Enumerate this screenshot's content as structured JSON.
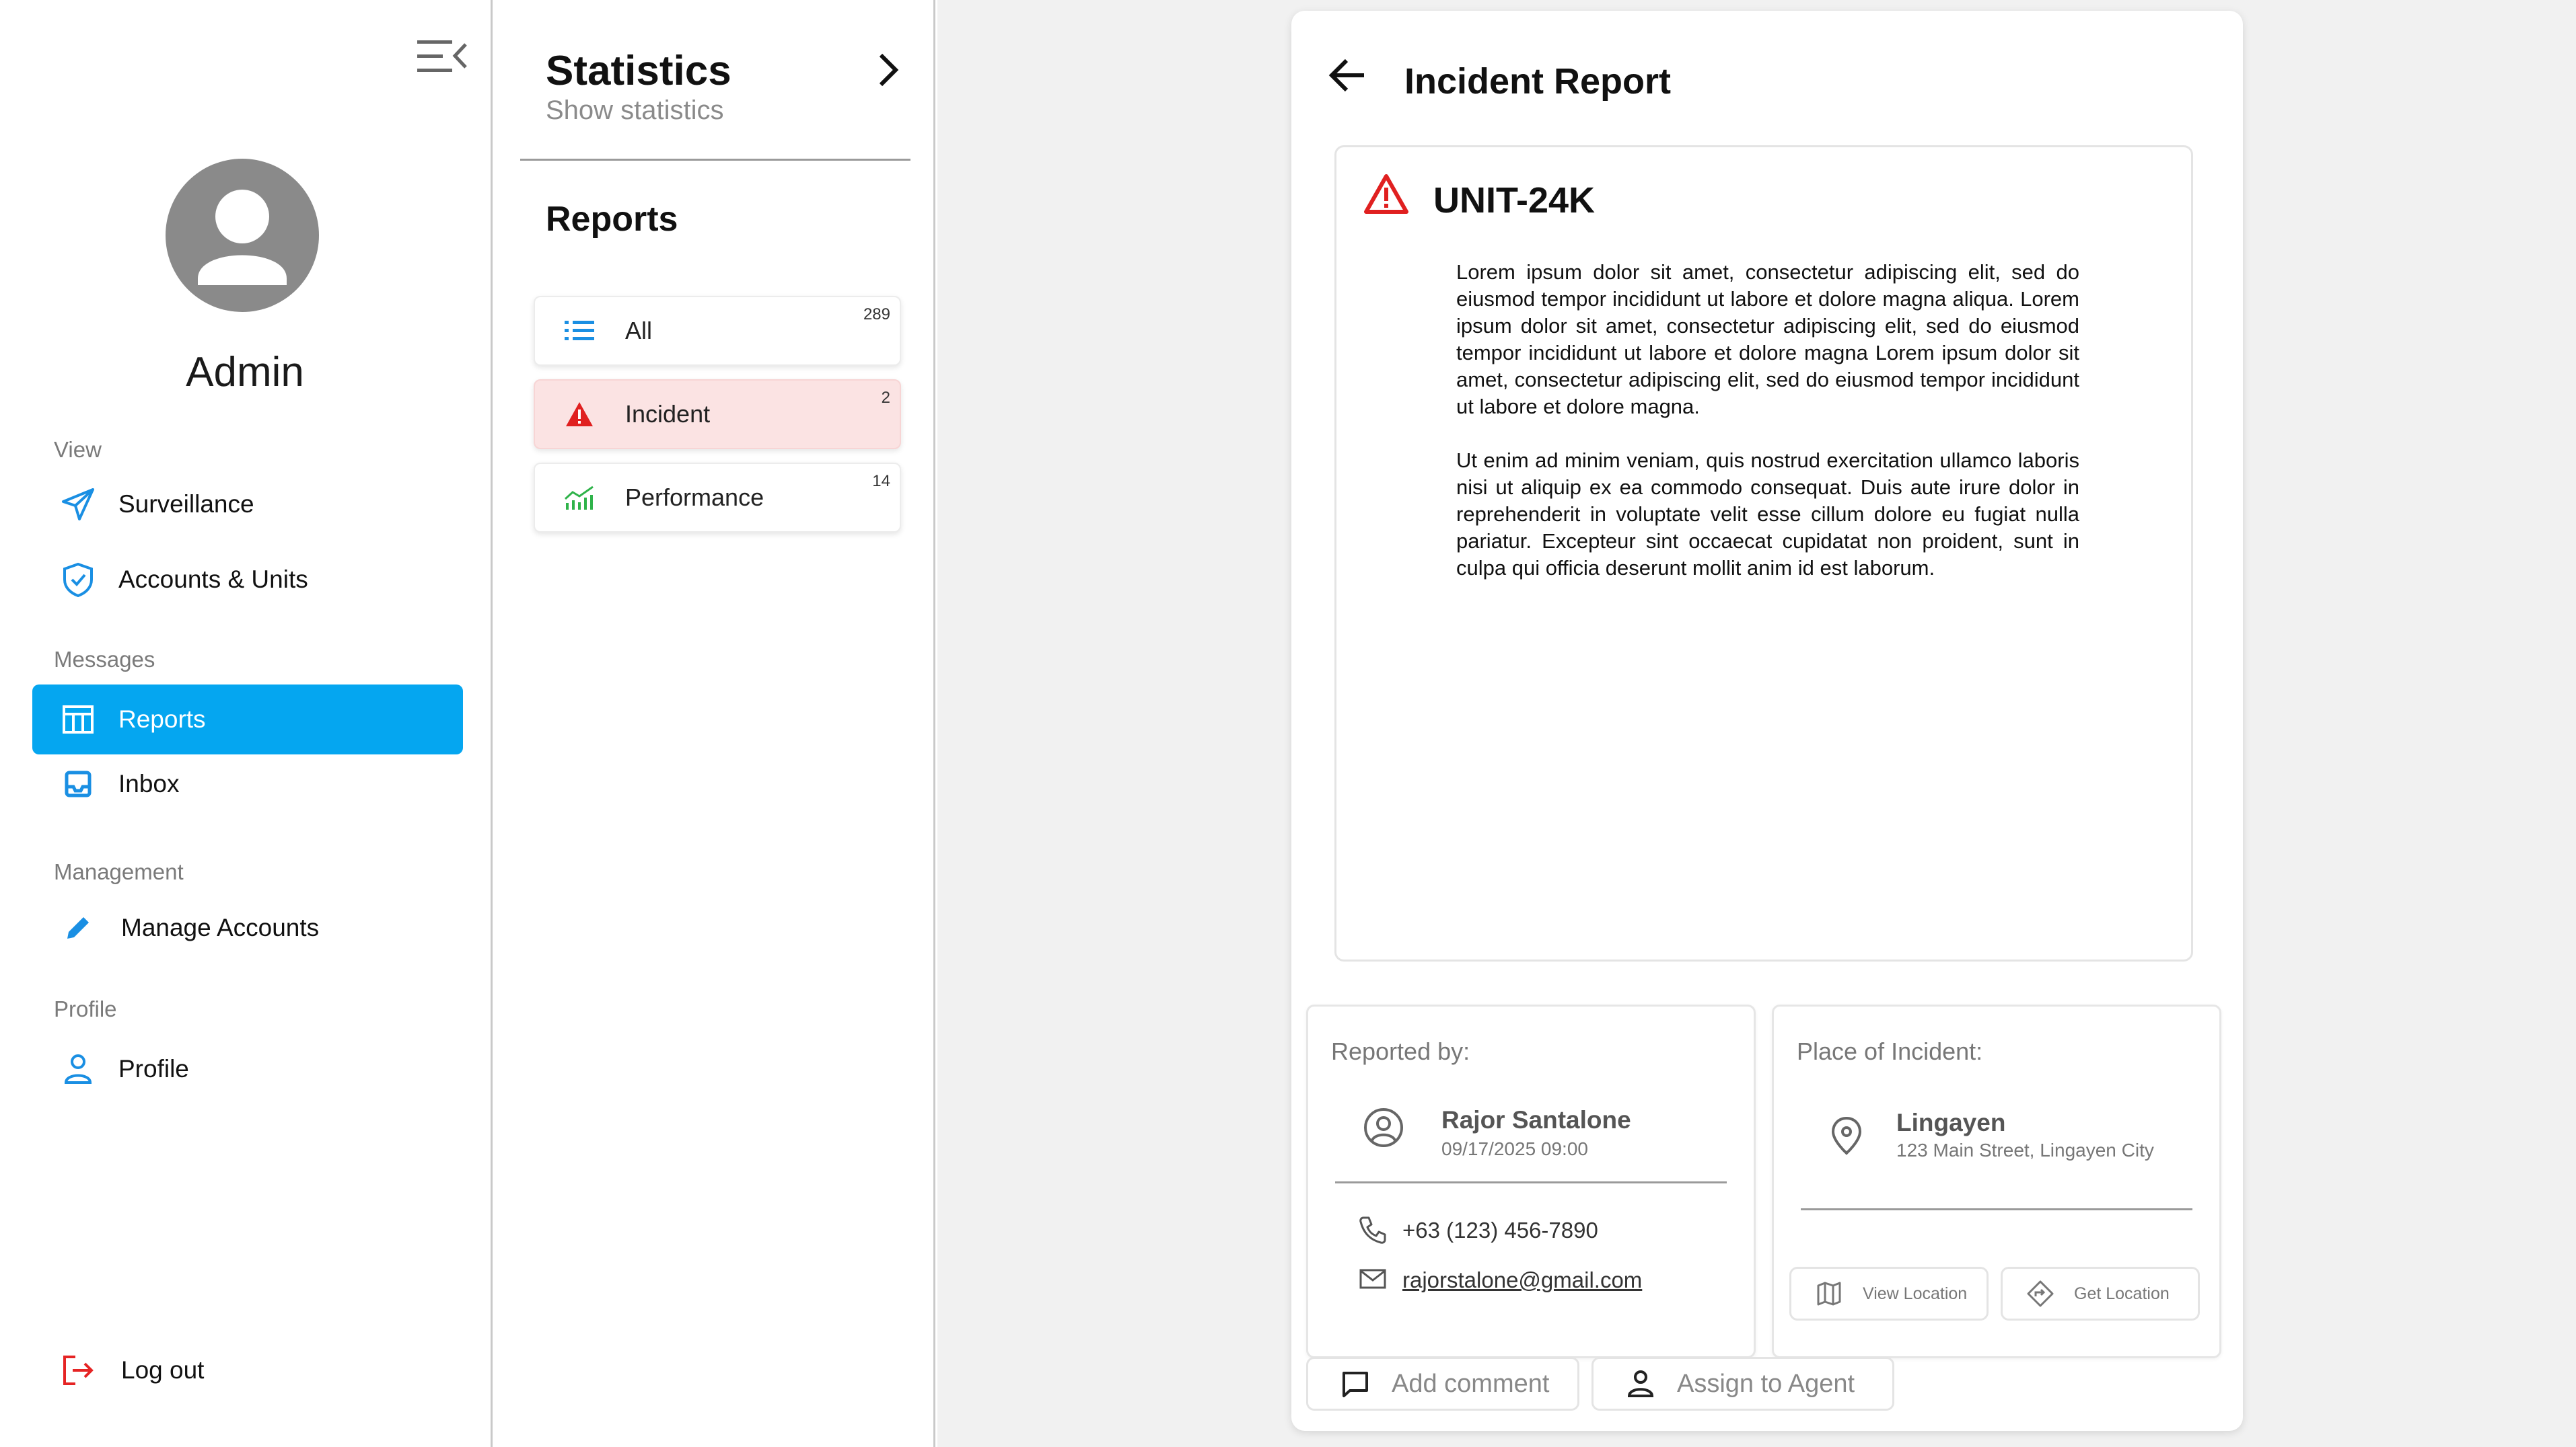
{
  "sidebar": {
    "user_name": "Admin",
    "sections": {
      "view": "View",
      "messages": "Messages",
      "management": "Management",
      "profile": "Profile"
    },
    "items": {
      "surveillance": "Surveillance",
      "accounts_units": "Accounts & Units",
      "reports": "Reports",
      "inbox": "Inbox",
      "manage_accounts": "Manage Accounts",
      "profile": "Profile",
      "logout": "Log out"
    },
    "active_item": "Reports",
    "accent_color": "#05a6f0"
  },
  "statistics": {
    "title": "Statistics",
    "subtitle": "Show statistics"
  },
  "reports_panel": {
    "title": "Reports",
    "categories": [
      {
        "label": "All",
        "count": "289",
        "icon": "list-icon"
      },
      {
        "label": "Incident",
        "count": "2",
        "icon": "warning-icon"
      },
      {
        "label": "Performance",
        "count": "14",
        "icon": "chart-icon"
      }
    ],
    "active_category": "Incident"
  },
  "report": {
    "title": "Incident Report",
    "unit": "UNIT-24K",
    "paragraphs": [
      "Lorem ipsum dolor sit amet, consectetur adipiscing elit, sed do eiusmod tempor incididunt ut labore et dolore magna aliqua. Lorem ipsum dolor sit amet, consectetur adipiscing elit, sed do eiusmod tempor incididunt ut labore et dolore magna Lorem ipsum dolor sit amet, consectetur adipiscing elit, sed do eiusmod tempor incididunt ut labore et dolore magna.",
      "Ut enim ad minim veniam, quis nostrud exercitation ullamco laboris nisi ut aliquip ex ea commodo consequat. Duis aute irure dolor in reprehenderit in voluptate velit esse cillum dolore eu fugiat nulla pariatur. Excepteur sint occaecat cupidatat non proident, sunt in culpa qui officia deserunt mollit anim id est laborum."
    ],
    "reported_by": {
      "label": "Reported by:",
      "name": "Rajor Santalone",
      "datetime": "09/17/2025 09:00",
      "phone": "+63 (123) 456-7890",
      "email": "rajorstalone@gmail.com"
    },
    "place": {
      "label": "Place of Incident:",
      "name": "Lingayen",
      "address": "123 Main Street, Lingayen City",
      "view_location": "View Location",
      "get_location": "Get Location"
    },
    "actions": {
      "add_comment": "Add comment",
      "assign_agent": "Assign to Agent"
    },
    "warning_color": "#e02020"
  }
}
